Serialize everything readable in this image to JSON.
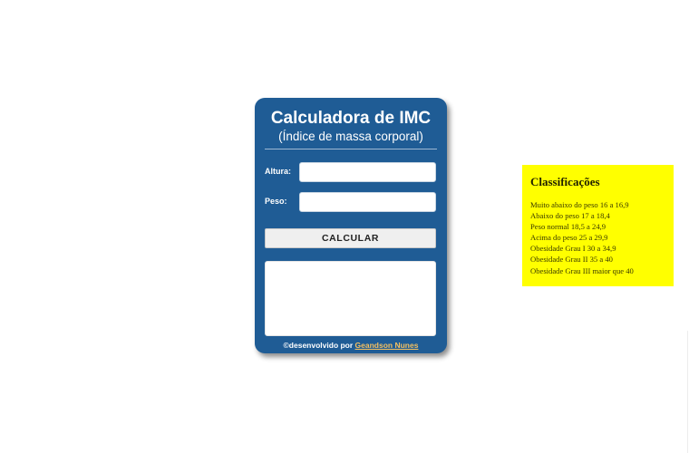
{
  "calculator": {
    "title": "Calculadora de IMC",
    "subtitle": "(Índice de massa corporal)",
    "height_label": "Altura:",
    "height_value": "",
    "weight_label": "Peso:",
    "weight_value": "",
    "button_label": "CALCULAR",
    "result_text": "",
    "footer_prefix": "©desenvolvido por ",
    "footer_link": "Geandson Nunes"
  },
  "classifications": {
    "title": "Classificações",
    "items": [
      "Muito abaixo do peso 16 a 16,9",
      "Abaixo do peso 17 a 18,4",
      "Peso normal 18,5 a 24,9",
      "Acima do peso 25 a 29,9",
      "Obesidade Grau I 30 a 34,9",
      "Obesidade Grau II 35 a 40",
      "Obesidade Grau III maior que 40"
    ]
  },
  "colors": {
    "card_background": "#1f5c95",
    "classification_background": "#ffff00",
    "link_color": "#f5c060"
  }
}
